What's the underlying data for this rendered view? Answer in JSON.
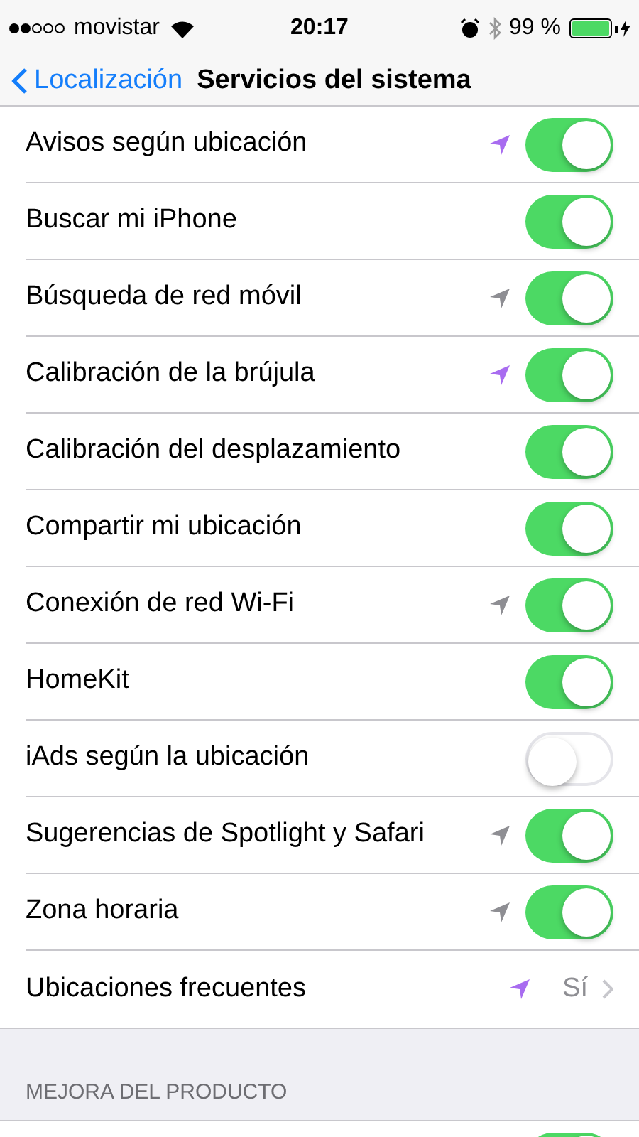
{
  "status_bar": {
    "carrier": "movistar",
    "time": "20:17",
    "battery": "99 %"
  },
  "nav": {
    "back": "Localización",
    "title": "Servicios del sistema"
  },
  "rows": [
    {
      "kind": "toggle",
      "label": "Avisos según ubicación",
      "color": "#a86cf0",
      "on": true
    },
    {
      "kind": "toggle",
      "label": "Buscar mi iPhone",
      "on": true
    },
    {
      "kind": "toggle",
      "label": "Búsqueda de red móvil",
      "color": "#8e8e93",
      "on": true
    },
    {
      "kind": "toggle",
      "label": "Calibración de la brújula",
      "color": "#a86cf0",
      "on": true
    },
    {
      "kind": "toggle",
      "label": "Calibración del desplazamiento",
      "on": true
    },
    {
      "kind": "toggle",
      "label": "Compartir mi ubicación",
      "on": true
    },
    {
      "kind": "toggle",
      "label": "Conexión de red Wi-Fi",
      "color": "#8e8e93",
      "on": true
    },
    {
      "kind": "toggle",
      "label": "HomeKit",
      "on": true
    },
    {
      "kind": "toggle",
      "label": "iAds según la ubicación",
      "on": false
    },
    {
      "kind": "toggle",
      "label": "Sugerencias de Spotlight y Safari",
      "color": "#8e8e93",
      "on": true
    },
    {
      "kind": "toggle",
      "label": "Zona horaria",
      "color": "#8e8e93",
      "on": true
    },
    {
      "kind": "disclosure",
      "label": "Ubicaciones frecuentes",
      "color": "#a86cf0",
      "value": "Sí"
    }
  ],
  "section": {
    "header": "MEJORA DEL PRODUCTO",
    "rows": [
      {
        "kind": "toggle",
        "on": true
      }
    ]
  }
}
